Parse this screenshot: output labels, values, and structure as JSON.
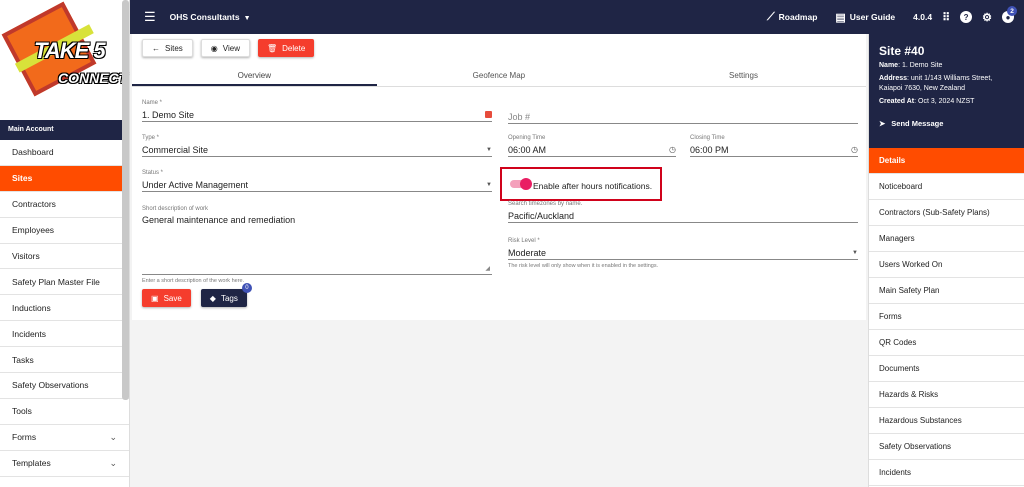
{
  "brand": {
    "logo_line1": "TAKE 5",
    "logo_line2": "CONNECT"
  },
  "topbar": {
    "org": "OHS Consultants",
    "roadmap": "Roadmap",
    "user_guide": "User Guide",
    "version": "4.0.4",
    "notification_count": "2"
  },
  "sidebar": {
    "section": "Main Account",
    "items": [
      {
        "label": "Dashboard"
      },
      {
        "label": "Sites"
      },
      {
        "label": "Contractors"
      },
      {
        "label": "Employees"
      },
      {
        "label": "Visitors"
      },
      {
        "label": "Safety Plan Master File"
      },
      {
        "label": "Inductions"
      },
      {
        "label": "Incidents"
      },
      {
        "label": "Tasks"
      },
      {
        "label": "Safety Observations"
      },
      {
        "label": "Tools"
      },
      {
        "label": "Forms"
      },
      {
        "label": "Templates"
      }
    ]
  },
  "toolbar": {
    "sites": "Sites",
    "view": "View",
    "delete": "Delete"
  },
  "tabs": [
    "Overview",
    "Geofence Map",
    "Settings"
  ],
  "form": {
    "name_label": "Name *",
    "name_value": "1. Demo Site",
    "job_placeholder": "Job #",
    "type_label": "Type *",
    "type_value": "Commercial Site",
    "opening_label": "Opening Time",
    "opening_value": "06:00 AM",
    "closing_label": "Closing Time",
    "closing_value": "06:00 PM",
    "status_label": "Status *",
    "status_value": "Under Active Management",
    "toggle_label": "Enable after hours notifications.",
    "desc_label": "Short description of work",
    "desc_value": "General maintenance and remediation",
    "desc_hint": "Enter a short description of the work here.",
    "tz_label": "Search timezones by name.",
    "tz_value": "Pacific/Auckland",
    "risk_label": "Risk Level *",
    "risk_value": "Moderate",
    "risk_hint": "The risk level will only show when it is enabled in the settings.",
    "save": "Save",
    "tags": "Tags",
    "tags_count": "0",
    "after_hours_enabled": true
  },
  "site": {
    "title": "Site #40",
    "name_key": "Name",
    "name": "1. Demo Site",
    "address_key": "Address",
    "address": "unit 1/143 Williams Street, Kaiapoi 7630, New Zealand",
    "created_key": "Created At",
    "created": "Oct 3, 2024 NZST",
    "send_message": "Send Message"
  },
  "rpanel": {
    "items": [
      {
        "label": "Details"
      },
      {
        "label": "Noticeboard"
      },
      {
        "label": "Contractors (Sub-Safety Plans)"
      },
      {
        "label": "Managers"
      },
      {
        "label": "Users Worked On"
      },
      {
        "label": "Main Safety Plan"
      },
      {
        "label": "Forms"
      },
      {
        "label": "QR Codes"
      },
      {
        "label": "Documents"
      },
      {
        "label": "Hazards & Risks"
      },
      {
        "label": "Hazardous Substances"
      },
      {
        "label": "Safety Observations"
      },
      {
        "label": "Incidents"
      }
    ]
  },
  "colors": {
    "navy": "#1f2545",
    "accent": "#ff4c00",
    "delete": "#f53d2d",
    "toggle": "#e91e63",
    "highlight": "#d0021b"
  }
}
